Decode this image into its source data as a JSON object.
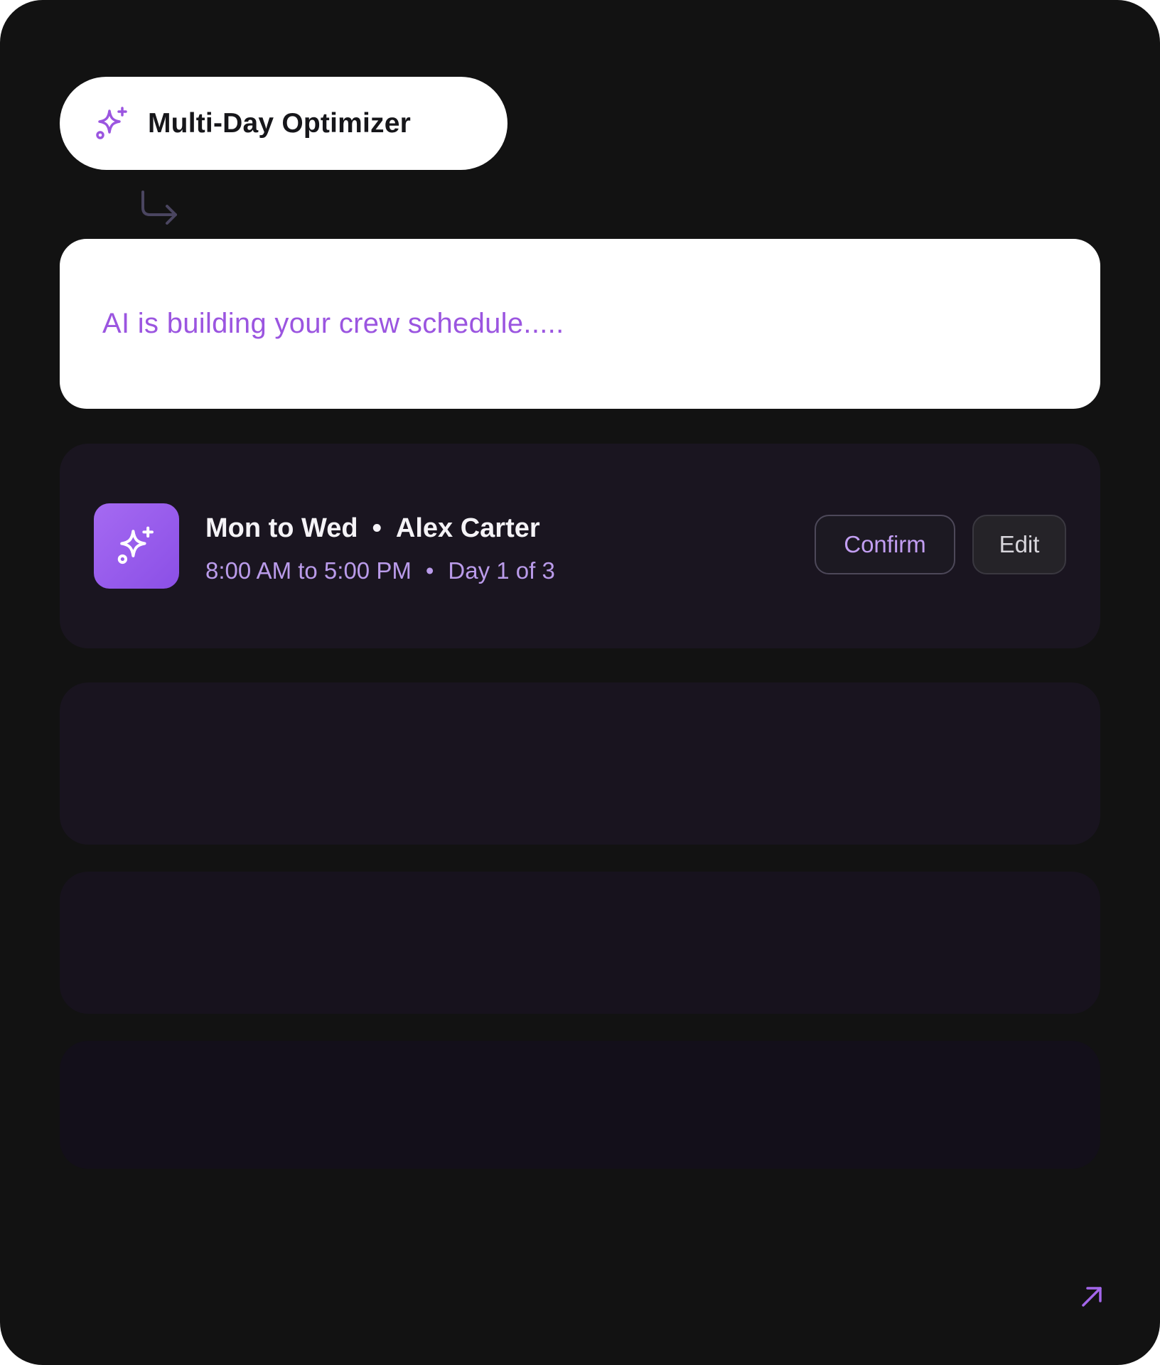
{
  "header": {
    "title": "Multi-Day Optimizer",
    "icon": "sparkles-icon"
  },
  "prompt": {
    "text": "AI is building your crew schedule....."
  },
  "schedule_card": {
    "days": "Mon to Wed",
    "separator": "•",
    "person": "Alex Carter",
    "time": "8:00 AM to 5:00 PM",
    "day_progress": "Day 1 of 3",
    "confirm_label": "Confirm",
    "edit_label": "Edit",
    "icon": "sparkles-icon"
  },
  "colors": {
    "background": "#121212",
    "accent": "#9b55e0",
    "badge": "#9b5cf0"
  }
}
